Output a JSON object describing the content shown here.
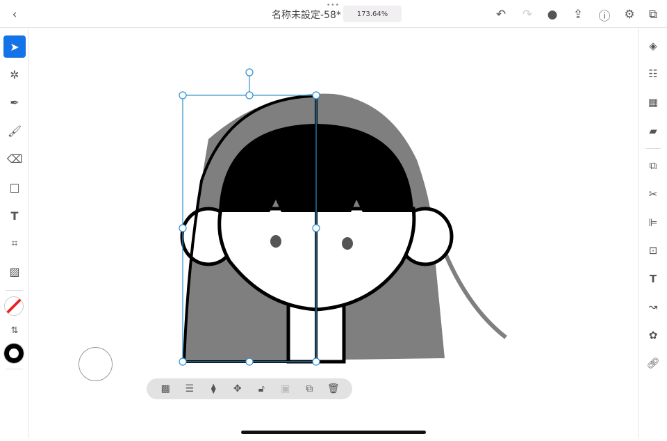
{
  "header": {
    "title": "名称未設定-58*",
    "zoom": "173.64%",
    "more": "•••"
  },
  "left_tools": [
    "select",
    "direct-select",
    "pen",
    "brush",
    "eraser",
    "rectangle",
    "text",
    "transform",
    "image"
  ],
  "right_panel": [
    "layers",
    "properties",
    "swatches",
    "comments",
    "pathfinder",
    "scissors",
    "align",
    "repeat",
    "type",
    "curvature",
    "shape-builder",
    "link"
  ],
  "context_bar": [
    "opacity",
    "stroke",
    "arrange",
    "move",
    "unlock",
    "mask",
    "duplicate",
    "delete"
  ],
  "colors": {
    "accent": "#1473e6",
    "hair": "#7f7f7f",
    "selection": "#2d8fcf"
  }
}
